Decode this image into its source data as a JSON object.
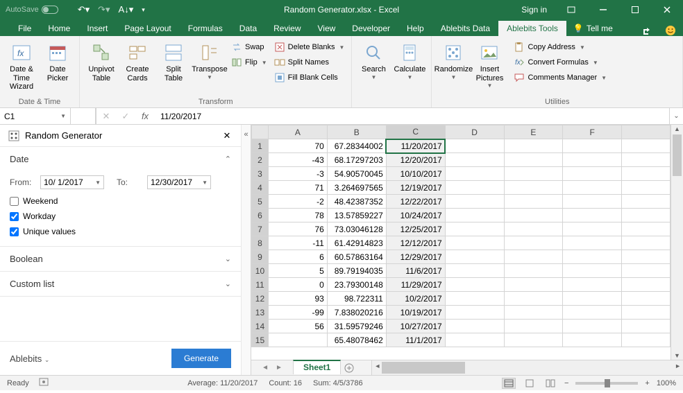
{
  "titlebar": {
    "autosave_label": "AutoSave",
    "title": "Random Generator.xlsx - Excel",
    "signin": "Sign in"
  },
  "tabs": {
    "items": [
      "File",
      "Home",
      "Insert",
      "Page Layout",
      "Formulas",
      "Data",
      "Review",
      "View",
      "Developer",
      "Help",
      "Ablebits Data",
      "Ablebits Tools"
    ],
    "active": 11,
    "tellme": "Tell me"
  },
  "ribbon": {
    "date_time": {
      "label": "Date & Time",
      "btn1_l1": "Date &",
      "btn1_l2": "Time Wizard",
      "btn2_l1": "Date",
      "btn2_l2": "Picker"
    },
    "transform": {
      "label": "Transform",
      "unpivot_l1": "Unpivot",
      "unpivot_l2": "Table",
      "create_l1": "Create",
      "create_l2": "Cards",
      "split_l1": "Split",
      "split_l2": "Table",
      "transpose": "Transpose",
      "swap": "Swap",
      "flip": "Flip",
      "delete_blanks": "Delete Blanks",
      "split_names": "Split Names",
      "fill_blank": "Fill Blank Cells"
    },
    "search": {
      "label": "Search"
    },
    "calculate": {
      "label": "Calculate"
    },
    "randomize": {
      "label": "Randomize"
    },
    "insert_pics": {
      "l1": "Insert",
      "l2": "Pictures"
    },
    "utilities": {
      "label": "Utilities",
      "copy_addr": "Copy Address",
      "convert": "Convert Formulas",
      "comments": "Comments Manager"
    }
  },
  "fbar": {
    "name": "C1",
    "formula": "11/20/2017"
  },
  "taskpane": {
    "title": "Random Generator",
    "sections": {
      "date": {
        "name": "Date",
        "from_lbl": "From:",
        "from_val": "10/ 1/2017",
        "to_lbl": "To:",
        "to_val": "12/30/2017",
        "weekend": "Weekend",
        "workday": "Workday",
        "unique": "Unique values",
        "weekend_chk": false,
        "workday_chk": true,
        "unique_chk": true
      },
      "boolean": {
        "name": "Boolean"
      },
      "custom": {
        "name": "Custom list"
      }
    },
    "brand": "Ablebits",
    "generate": "Generate"
  },
  "sheet": {
    "columns": [
      "A",
      "B",
      "C",
      "D",
      "E",
      "F"
    ],
    "rows": [
      {
        "n": 1,
        "a": "70",
        "b": "67.28344002",
        "c": "11/20/2017"
      },
      {
        "n": 2,
        "a": "-43",
        "b": "68.17297203",
        "c": "12/20/2017"
      },
      {
        "n": 3,
        "a": "-3",
        "b": "54.90570045",
        "c": "10/10/2017"
      },
      {
        "n": 4,
        "a": "71",
        "b": "3.264697565",
        "c": "12/19/2017"
      },
      {
        "n": 5,
        "a": "-2",
        "b": "48.42387352",
        "c": "12/22/2017"
      },
      {
        "n": 6,
        "a": "78",
        "b": "13.57859227",
        "c": "10/24/2017"
      },
      {
        "n": 7,
        "a": "76",
        "b": "73.03046128",
        "c": "12/25/2017"
      },
      {
        "n": 8,
        "a": "-11",
        "b": "61.42914823",
        "c": "12/12/2017"
      },
      {
        "n": 9,
        "a": "6",
        "b": "60.57863164",
        "c": "12/29/2017"
      },
      {
        "n": 10,
        "a": "5",
        "b": "89.79194035",
        "c": "11/6/2017"
      },
      {
        "n": 11,
        "a": "0",
        "b": "23.79300148",
        "c": "11/29/2017"
      },
      {
        "n": 12,
        "a": "93",
        "b": "98.722311",
        "c": "10/2/2017"
      },
      {
        "n": 13,
        "a": "-99",
        "b": "7.838020216",
        "c": "10/19/2017"
      },
      {
        "n": 14,
        "a": "56",
        "b": "31.59579246",
        "c": "10/27/2017"
      },
      {
        "n": 15,
        "a": "",
        "b": "65.48078462",
        "c": "11/1/2017"
      }
    ],
    "tab": "Sheet1"
  },
  "status": {
    "ready": "Ready",
    "avg": "Average: 11/20/2017",
    "count": "Count: 16",
    "sum": "Sum: 4/5/3786",
    "zoom": "100%"
  }
}
